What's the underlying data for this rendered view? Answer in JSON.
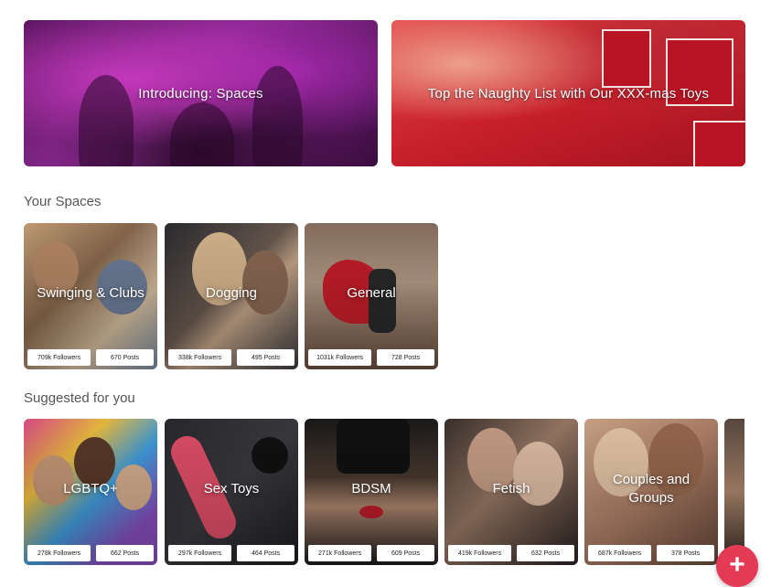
{
  "banners": [
    {
      "label": "Introducing: Spaces"
    },
    {
      "label": "Top the Naughty List with Our XXX-mas Toys"
    }
  ],
  "your_spaces": {
    "title": "Your Spaces",
    "cards": [
      {
        "title": "Swinging & Clubs",
        "followers": "709k Followers",
        "posts": "670 Posts"
      },
      {
        "title": "Dogging",
        "followers": "338k Followers",
        "posts": "495 Posts"
      },
      {
        "title": "General",
        "followers": "1031k Followers",
        "posts": "728 Posts"
      }
    ]
  },
  "suggested": {
    "title": "Suggested for you",
    "cards": [
      {
        "title": "LGBTQ+",
        "followers": "278k Followers",
        "posts": "662 Posts"
      },
      {
        "title": "Sex Toys",
        "followers": "297k Followers",
        "posts": "464 Posts"
      },
      {
        "title": "BDSM",
        "followers": "271k Followers",
        "posts": "609 Posts"
      },
      {
        "title": "Fetish",
        "followers": "419k Followers",
        "posts": "632 Posts"
      },
      {
        "title": "Couples and Groups",
        "followers": "687k Followers",
        "posts": "378 Posts"
      }
    ]
  },
  "fab": {
    "icon": "plus-icon",
    "symbol": "+"
  },
  "colors": {
    "accent": "#e43a55"
  }
}
